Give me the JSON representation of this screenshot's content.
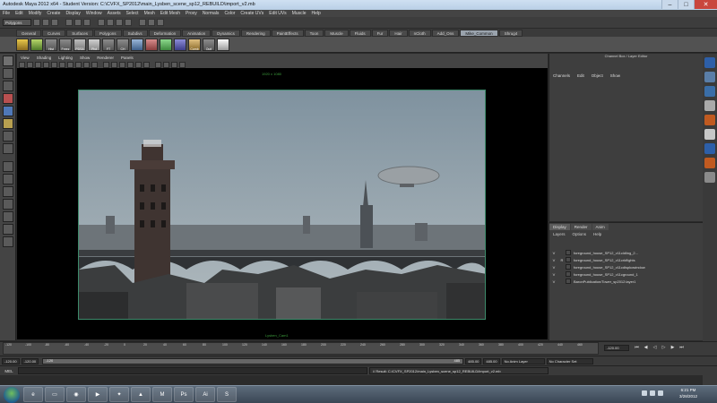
{
  "window": {
    "title": "Autodesk Maya 2012 x64 - Student Version: C:\\CVFX_SP2012\\main_Lysben_scene_sp12_REBUILD\\import_v2.mb"
  },
  "menubar": [
    "File",
    "Edit",
    "Modify",
    "Create",
    "Display",
    "Window",
    "Assets",
    "Select",
    "Mesh",
    "Edit Mesh",
    "Proxy",
    "Normals",
    "Color",
    "Create UVs",
    "Edit UVs",
    "Muscle",
    "Help"
  ],
  "statusline": {
    "mode": "Polygons"
  },
  "shelf": {
    "tabs": [
      "General",
      "Curves",
      "Surfaces",
      "Polygons",
      "Subdivs",
      "Deformation",
      "Animation",
      "Dynamics",
      "Rendering",
      "PaintEffects",
      "Toon",
      "Muscle",
      "Fluids",
      "Fur",
      "Hair",
      "nCloth",
      "Add_Ons",
      "Mike_Common",
      "Shrug4"
    ],
    "active_tab": "Mike_Common",
    "icon_labels": [
      "",
      "",
      "Hist",
      "Freez",
      "PDSA",
      "Pivt",
      "FT",
      "CH",
      "",
      "",
      "",
      "",
      "Comb",
      "Outf",
      ""
    ]
  },
  "panel": {
    "menu": [
      "View",
      "Shading",
      "Lighting",
      "Show",
      "Renderer",
      "Panels"
    ],
    "resolution_label": "1920 x 1080",
    "camera_label": "Lysben_Cam1"
  },
  "channel_box": {
    "header": "Channel Box / Layer Editor",
    "menu": [
      "Channels",
      "Edit",
      "Object",
      "Show"
    ]
  },
  "layer_editor": {
    "tabs": [
      "Display",
      "Render",
      "Anim"
    ],
    "menu": [
      "Layers",
      "Options",
      "Help"
    ],
    "layers": [
      {
        "v": "V",
        "r": "",
        "name": "foreground_house_SP12_v11cldling_2..."
      },
      {
        "v": "V",
        "r": "R",
        "name": "foreground_house_SP12_v11crkflights"
      },
      {
        "v": "V",
        "r": "",
        "name": "foreground_house_SP12_v11cdispkowindow"
      },
      {
        "v": "V",
        "r": "",
        "name": "foreground_house_SP12_v11cground_1"
      },
      {
        "v": "V",
        "r": "",
        "name": "BaronPublication/Tower_sp2012:layer1"
      }
    ]
  },
  "time_slider": {
    "ticks": [
      "-120",
      "-100",
      "-80",
      "-60",
      "-40",
      "-20",
      "0",
      "20",
      "40",
      "60",
      "80",
      "100",
      "120",
      "140",
      "160",
      "180",
      "200",
      "220",
      "240",
      "260",
      "280",
      "300",
      "320",
      "340",
      "360",
      "380",
      "400",
      "420",
      "440",
      "460"
    ],
    "current_frame": "-120.00"
  },
  "range_slider": {
    "start": "-120.00",
    "inner_start": "-120.00",
    "bar_label": "-120",
    "bar_end": "485",
    "inner_end": "485.00",
    "end": "485.00",
    "anim_layer": "No Anim Layer",
    "char_set": "No Character Set"
  },
  "command_line": {
    "mel_label": "MEL",
    "result": "// Result: C:/CVFX_SP2012/main_Lysben_scene_sp12_REBUILD/import_v2.mb"
  },
  "taskbar": {
    "time": "6:21 PM",
    "date": "3/28/2012",
    "apps": [
      "ie-icon",
      "folder-icon",
      "firefox-icon",
      "media-icon",
      "aim-icon",
      "vlc-icon",
      "maya-icon",
      "photoshop-icon",
      "ai-icon",
      "skype-icon"
    ]
  },
  "colors": {
    "sky_top": "#8093a0",
    "sky_bottom": "#aeb8bd",
    "shelf_active": "#9aa3ad",
    "viewport_border": "#3d8a6a"
  }
}
